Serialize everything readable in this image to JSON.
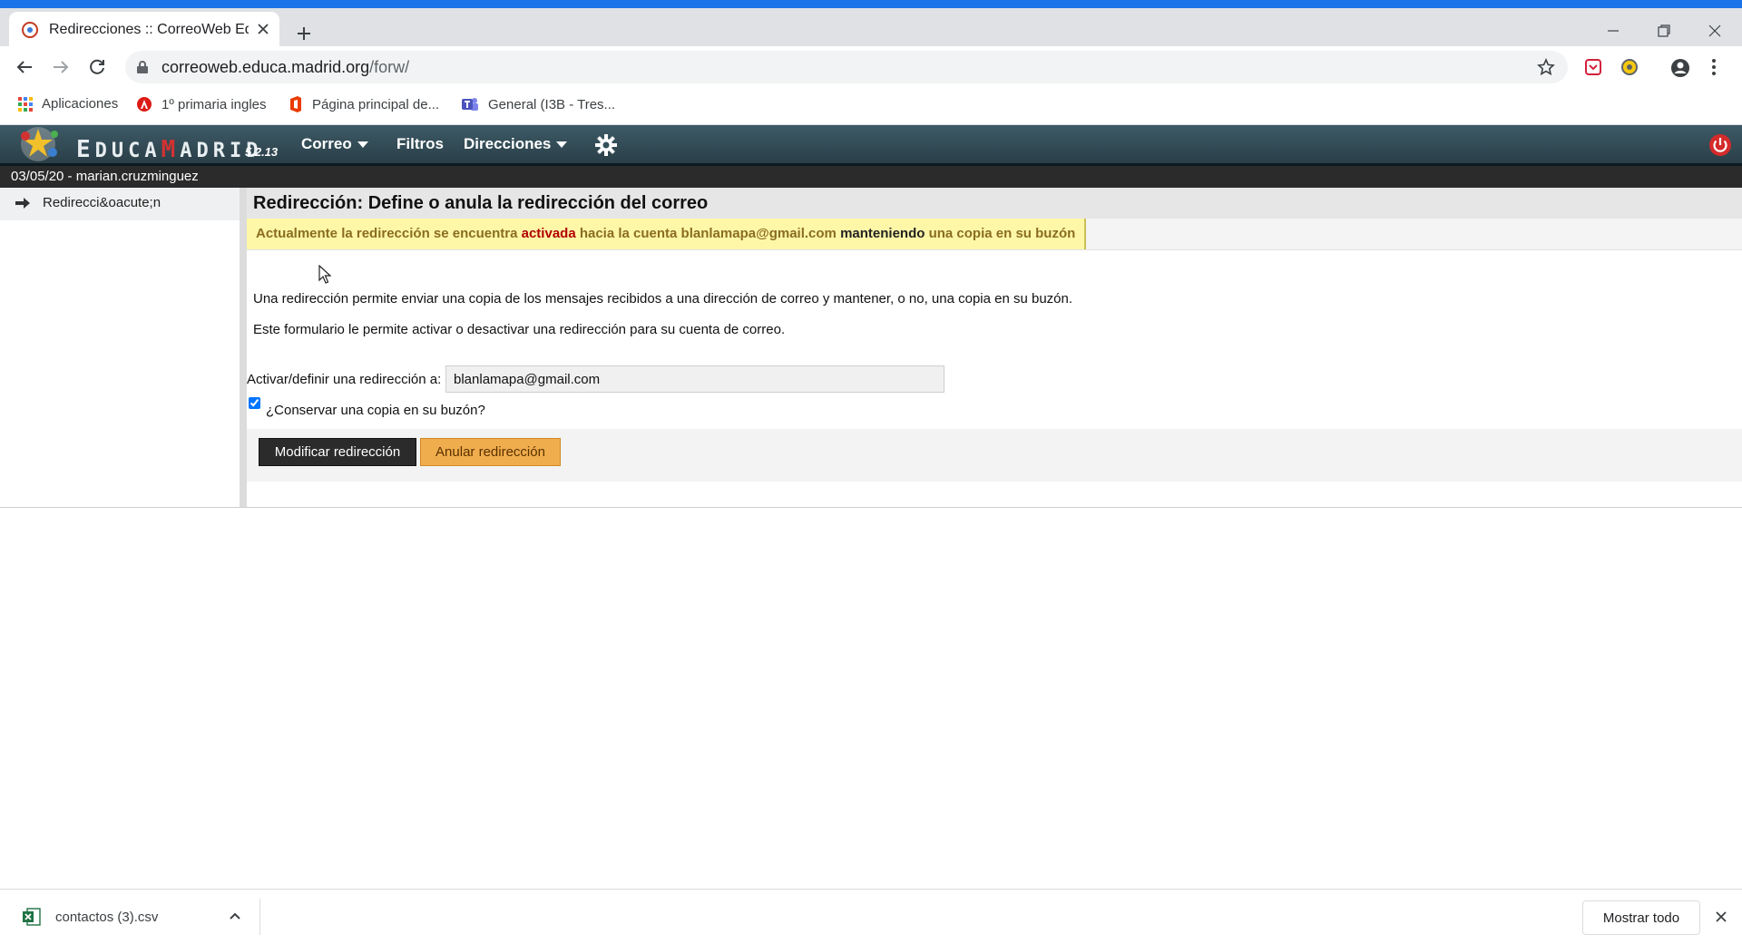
{
  "browser": {
    "tab_title": "Redirecciones :: CorreoWeb Educ",
    "url_domain": "correoweb.educa.madrid.org",
    "url_path": "/forw/",
    "accent_color": "#1a73e8"
  },
  "bookmarks": [
    {
      "label": "Aplicaciones",
      "icon": "apps-grid-icon"
    },
    {
      "label": "1º primaria ingles",
      "icon": "angular-icon"
    },
    {
      "label": "Página principal de...",
      "icon": "office-icon"
    },
    {
      "label": "General (I3B - Tres...",
      "icon": "teams-icon"
    }
  ],
  "app": {
    "logo_text_1": "E",
    "logo_text_2": "DUCA",
    "logo_text_3": "M",
    "logo_text_4": "ADRID",
    "version": "5.2.13",
    "menu": {
      "correo": "Correo",
      "filtros": "Filtros",
      "direcciones": "Direcciones"
    },
    "session_info": "03/05/20 - marian.cruzminguez"
  },
  "sidebar": {
    "items": [
      {
        "label": "Redirecci&oacute;n"
      }
    ]
  },
  "main": {
    "title": "Redirección: Define o anula la redirección del correo",
    "notice": {
      "part1": "Actualmente la redirección se encuentra ",
      "status": "activada",
      "part2": " hacia la cuenta blanlamapa@gmail.com ",
      "mode": "manteniendo",
      "part3": " una copia en su buzón"
    },
    "description_1": "Una redirección permite enviar una copia de los mensajes recibidos a una dirección de correo y mantener, o no, una copia en su buzón.",
    "description_2": "Este formulario le permite activar o desactivar una redirección para su cuenta de correo.",
    "field_label": "Activar/definir una redirección a:",
    "field_value": "blanlamapa@gmail.com",
    "keep_copy_label": "¿Conservar una copia en su buzón?",
    "keep_copy_checked": true,
    "modify_button": "Modificar redirección",
    "cancel_button": "Anular redirección"
  },
  "downloads": {
    "file_name": "contactos (3).csv",
    "show_all": "Mostrar todo"
  }
}
